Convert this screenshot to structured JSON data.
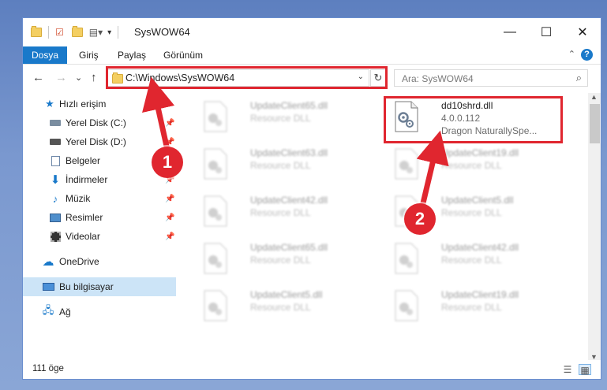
{
  "window": {
    "title": "SysWOW64",
    "minimize": "—",
    "maximize": "☐",
    "close": "✕"
  },
  "ribbon": {
    "tabs": [
      "Dosya",
      "Giriş",
      "Paylaş",
      "Görünüm"
    ],
    "help": "?",
    "collapse": "⌃"
  },
  "nav": {
    "back": "←",
    "forward": "→",
    "recent": "⌄",
    "up": "↑",
    "address": "C:\\Windows\\SysWOW64",
    "address_dropdown": "⌄",
    "refresh": "↻",
    "search_placeholder": "Ara: SysWOW64",
    "search_icon": "⌕"
  },
  "sidebar": {
    "items": [
      {
        "label": "Hızlı erişim",
        "icon": "star-icon",
        "pinned": false
      },
      {
        "label": "Yerel Disk (C:)",
        "icon": "disk-icon",
        "pinned": true
      },
      {
        "label": "Yerel Disk (D:)",
        "icon": "disk-icon",
        "pinned": true
      },
      {
        "label": "Belgeler",
        "icon": "documents-icon",
        "pinned": true
      },
      {
        "label": "İndirmeler",
        "icon": "download-icon",
        "pinned": true
      },
      {
        "label": "Müzik",
        "icon": "music-icon",
        "pinned": true
      },
      {
        "label": "Resimler",
        "icon": "pictures-icon",
        "pinned": true
      },
      {
        "label": "Videolar",
        "icon": "videos-icon",
        "pinned": true
      },
      {
        "label": "OneDrive",
        "icon": "cloud-icon",
        "pinned": false
      },
      {
        "label": "Bu bilgisayar",
        "icon": "computer-icon",
        "pinned": false,
        "selected": true
      },
      {
        "label": "Ağ",
        "icon": "network-icon",
        "pinned": false
      }
    ],
    "pin_glyph": "📌"
  },
  "files": [
    {
      "name": "UpdateClient65.dll",
      "type": "Resource DLL",
      "blurred": true
    },
    {
      "name": "dd10shrd.dll",
      "version": "4.0.0.112",
      "type": "Dragon NaturallySpe...",
      "blurred": false
    },
    {
      "name": "UpdateClient63.dll",
      "type": "Resource DLL",
      "blurred": true
    },
    {
      "name": "UpdateClient19.dll",
      "type": "Resource DLL",
      "blurred": true
    },
    {
      "name": "UpdateClient42.dll",
      "type": "Resource DLL",
      "blurred": true
    },
    {
      "name": "UpdateClient5.dll",
      "type": "Resource DLL",
      "blurred": true
    },
    {
      "name": "UpdateClient65.dll",
      "type": "Resource DLL",
      "blurred": true
    },
    {
      "name": "UpdateClient42.dll",
      "type": "Resource DLL",
      "blurred": true
    },
    {
      "name": "UpdateClient5.dll",
      "type": "Resource DLL",
      "blurred": true
    },
    {
      "name": "UpdateClient19.dll",
      "type": "Resource DLL",
      "blurred": true
    }
  ],
  "status": {
    "count": "111 öge"
  },
  "annotations": {
    "badge1": "1",
    "badge2": "2",
    "color": "#e0262f"
  },
  "scrollbar": {
    "up": "▲",
    "down": "▼"
  },
  "view_buttons": [
    "☰",
    "▦"
  ]
}
